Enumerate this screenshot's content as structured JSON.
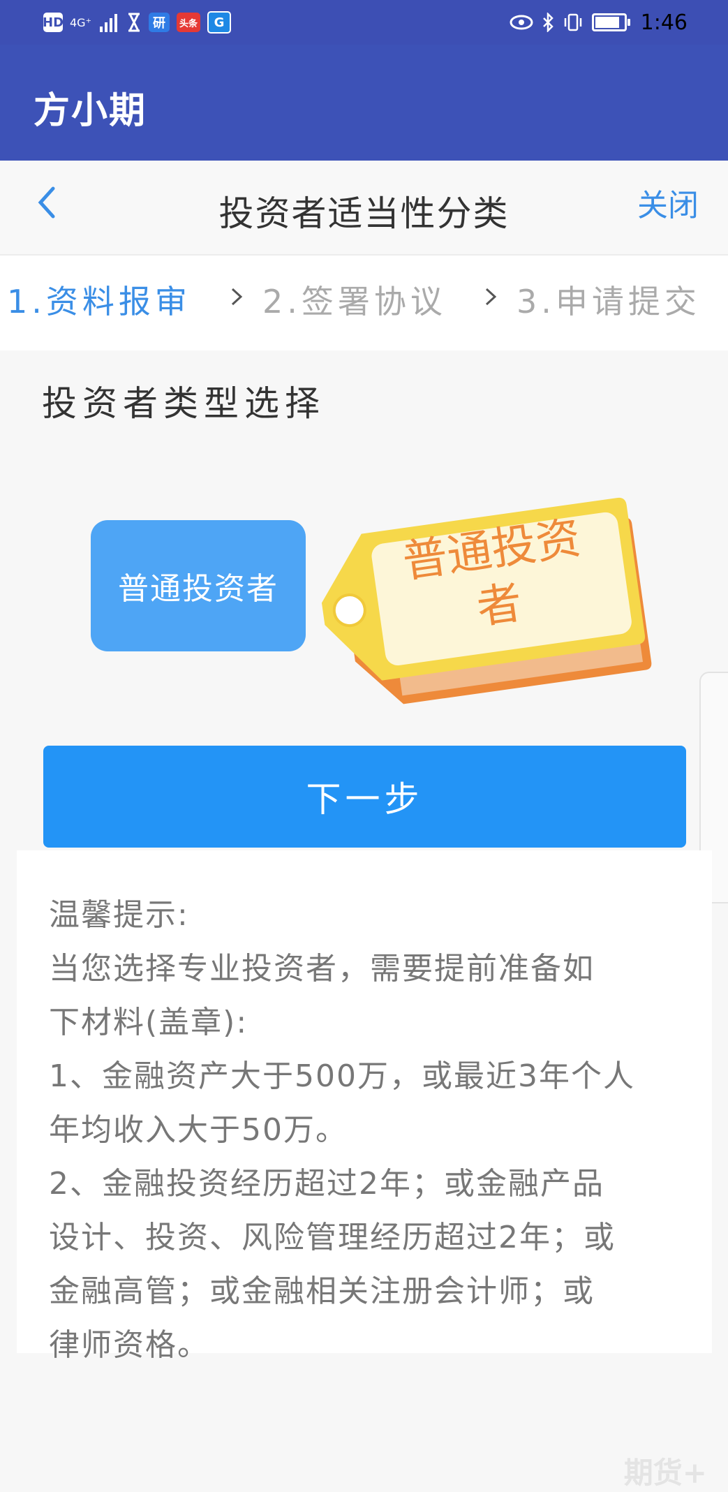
{
  "status_bar": {
    "left_chips": [
      "HD",
      "4G⁺",
      "研",
      "头条",
      "G"
    ],
    "time": "1:46"
  },
  "app": {
    "title": "方小期"
  },
  "header": {
    "title": "投资者适当性分类",
    "close_label": "关闭"
  },
  "steps": [
    {
      "label": "1.资料报审",
      "active": true
    },
    {
      "label": "2.签署协议",
      "active": false
    },
    {
      "label": "3.申请提交",
      "active": false
    }
  ],
  "section_title": "投资者类型选择",
  "investor_type_button": "普通投资者",
  "tag_text": [
    "普通投资",
    "者"
  ],
  "next_button": "下一步",
  "tips": {
    "lines": [
      "温馨提示:",
      "当您选择专业投资者，需要提前准备如",
      "下材料(盖章):",
      "1、金融资产大于500万，或最近3年个人",
      "年均收入大于50万。",
      "2、金融投资经历超过2年；或金融产品",
      "设计、投资、风险管理经历超过2年；或",
      "金融高管；或金融相关注册会计师；或",
      "律师资格。"
    ]
  },
  "watermark": "期货+",
  "colors": {
    "status_bar": "#3d4fb4",
    "app_bar": "#3d52b7",
    "accent": "#3a8ee6",
    "primary_button": "#2394f6",
    "type_button": "#4ea5f5",
    "tag_yellow": "#f6d84a",
    "tag_orange": "#ee8a3a"
  }
}
